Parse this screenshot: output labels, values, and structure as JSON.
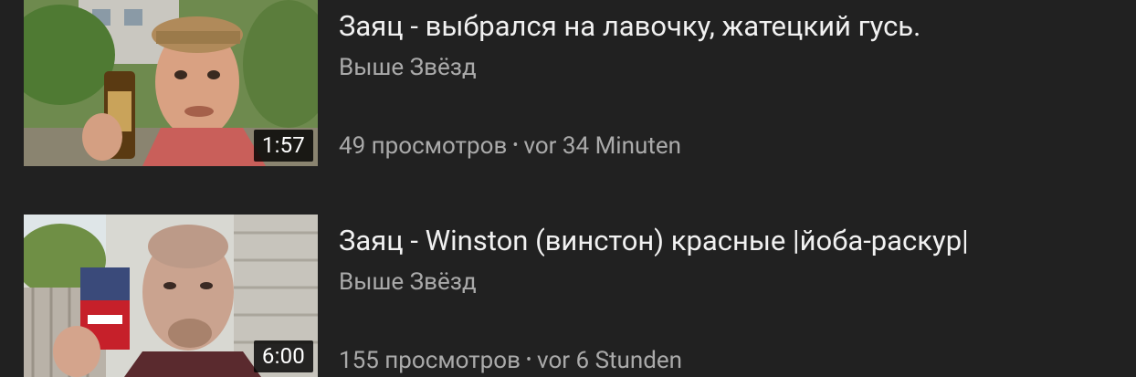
{
  "videos": [
    {
      "title": "Заяц - выбрался на лавочку, жатецкий гусь.",
      "channel": "Выше Звёзд",
      "views": "49 просмотров",
      "separator": "•",
      "age": "vor 34 Minuten",
      "duration": "1:57"
    },
    {
      "title": "Заяц - Winston (винстон) красные |йоба-раскур|",
      "channel": "Выше Звёзд",
      "views": "155 просмотров",
      "separator": "•",
      "age": "vor 6 Stunden",
      "duration": "6:00"
    }
  ],
  "colors": {
    "background": "#212121",
    "title": "#f1f1f1",
    "secondary": "#aaaaaa",
    "duration_bg": "#000000"
  }
}
